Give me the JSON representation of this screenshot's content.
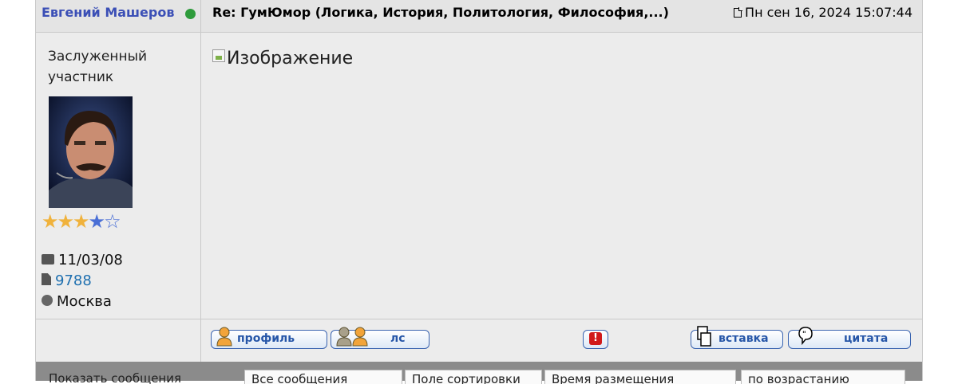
{
  "post": {
    "author": "Евгений Машеров",
    "author_status": "online",
    "title": "Re: ГумЮмор (Логика, История, Политология, Философия,...)",
    "date": "Пн сен 16, 2024 15:07:44",
    "rank": "Заслуженный участник",
    "rating_stars": 4.5,
    "joined": "11/03/08",
    "posts_count": "9788",
    "location": "Москва",
    "image_alt": "Изображение"
  },
  "buttons": {
    "profile": "профиль",
    "pm": "лс",
    "quote_insert": "вставка",
    "quote": "цитата"
  },
  "bottom_bar": {
    "cells": [
      "Показать сообщения",
      "Все сообщения",
      "Поле сортировки",
      "Время размещения",
      "по возрастанию"
    ]
  },
  "colors": {
    "author": "#3b4fb6",
    "online": "#2e9b3b",
    "link": "#1f70b0",
    "button_border": "#3a64b0",
    "report": "#d11a1a"
  },
  "icons": {
    "date": "document-icon",
    "joined": "briefcase-icon",
    "posts": "file-icon",
    "location": "globe-icon",
    "profile": "person-icon",
    "pm": "two-persons-icon",
    "report": "exclamation-icon",
    "insert": "paste-icon",
    "quote": "quote-bubble-icon"
  }
}
